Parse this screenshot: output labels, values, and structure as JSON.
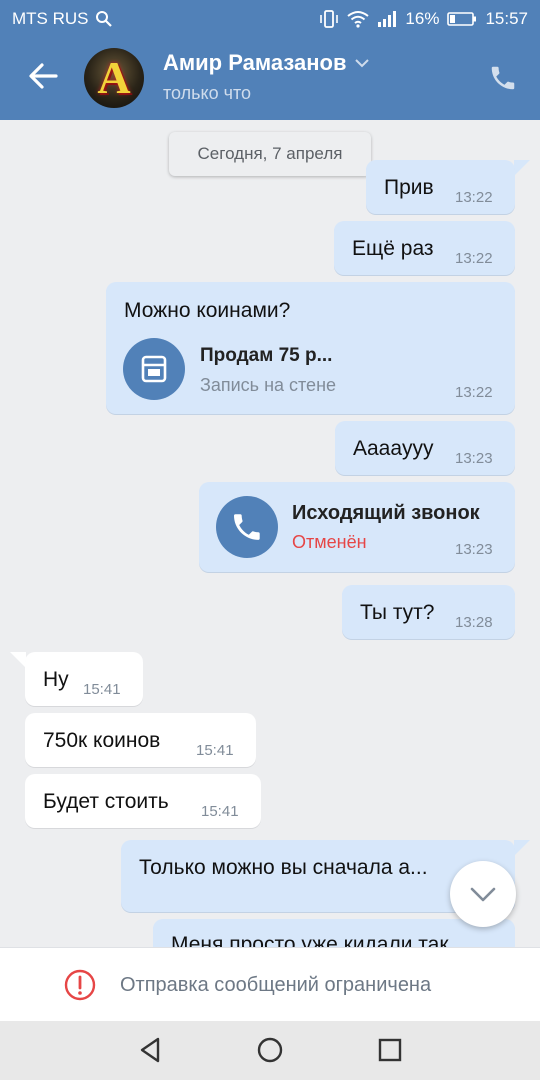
{
  "status_bar": {
    "carrier": "MTS RUS",
    "battery": "16%",
    "time": "15:57"
  },
  "header": {
    "name": "Амир Рамазанов",
    "presence": "только что",
    "avatar_letter": "A"
  },
  "date_separator": "Сегодня, 7 апреля",
  "messages": [
    {
      "text": "Прив",
      "time": "13:22"
    },
    {
      "text": "Ещё раз",
      "time": "13:22"
    },
    {
      "text": "Можно коинами?",
      "time": "13:22",
      "attachment_title": "Продам 75 р...",
      "attachment_subtitle": "Запись на стене"
    },
    {
      "text": "Aaaayyy",
      "time": "13:23"
    },
    {
      "call_title": "Исходящий звонок",
      "call_status": "Отменён",
      "time": "13:23"
    },
    {
      "text": "Ты тут?",
      "time": "13:28"
    },
    {
      "text": "Ну",
      "time": "15:41"
    },
    {
      "text": "750к коинов",
      "time": "15:41"
    },
    {
      "text": "Будет стоить",
      "time": "15:41"
    },
    {
      "text": "Только можно вы сначала а..."
    },
    {
      "text": "Меня просто уже кидали так"
    }
  ],
  "restriction_text": "Отправка сообщений ограничена",
  "colors": {
    "header": "#5181b8",
    "outgoing_bubble": "#d7e7fa",
    "incoming_bubble": "#ffffff",
    "declined": "#e64646",
    "warning": "#e64646"
  },
  "icons": [
    "search-icon",
    "vibrate-icon",
    "wifi-icon",
    "signal-icon",
    "battery-icon",
    "back-arrow-icon",
    "chevron-down-icon",
    "phone-icon",
    "wall-post-icon",
    "call-icon",
    "scroll-down-icon",
    "warning-icon",
    "nav-back-icon",
    "nav-home-icon",
    "nav-recents-icon"
  ]
}
